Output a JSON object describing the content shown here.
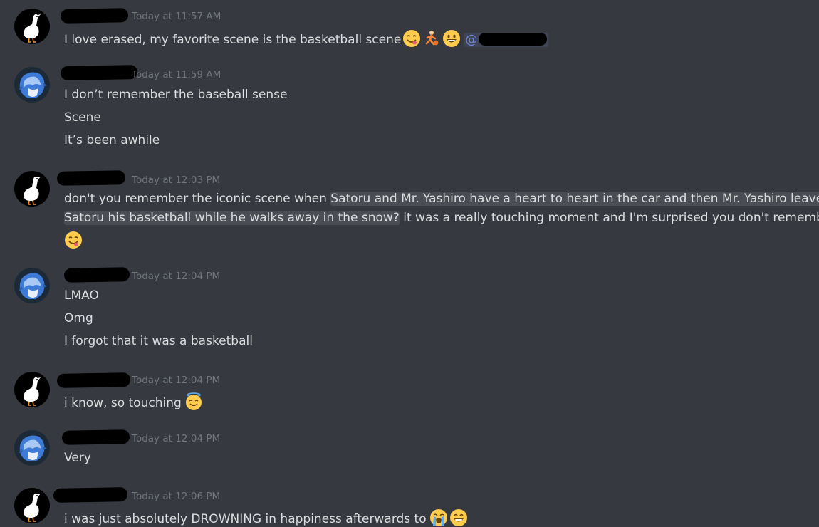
{
  "messages": [
    {
      "avatar": "goose-avatar",
      "time": "Today at 11:57 AM",
      "line1": "I love erased, my favorite scene is the basketball scene",
      "mention_prefix": "@"
    },
    {
      "avatar": "blue-hair-avatar",
      "time": "Today at 11:59 AM",
      "lines": [
        "I don’t remember the baseball sense",
        "Scene",
        "It’s been awhile"
      ]
    },
    {
      "avatar": "goose-avatar",
      "time": "Today at 12:03 PM",
      "part_a": "don't you remember the iconic scene when ",
      "highlight_1": "Satoru and Mr. Yashiro have a heart to heart in the car and then Mr. Yashiro leaves",
      "highlight_2": "Satoru his basketball while he walks away in the snow?",
      "part_b": " it was a really touching moment and I'm surprised you don't remember"
    },
    {
      "avatar": "blue-hair-avatar",
      "time": "Today at 12:04 PM",
      "lines": [
        "LMAO",
        "Omg",
        "I forgot that it was a basketball"
      ]
    },
    {
      "avatar": "goose-avatar",
      "time": "Today at 12:04 PM",
      "line1": "i know, so touching"
    },
    {
      "avatar": "blue-hair-avatar",
      "time": "Today at 12:04 PM",
      "line1": "Very"
    },
    {
      "avatar": "goose-avatar",
      "time": "Today at 12:06 PM",
      "line1": "i was just absolutely DROWNING in happiness afterwards to"
    }
  ],
  "emoji": {
    "yum": "face-savoring-food-emoji",
    "basketball_player": "person-bouncing-ball-emoji",
    "grin": "grinning-face-emoji",
    "innocent": "smiling-face-with-halo-emoji",
    "sob": "loudly-crying-face-emoji",
    "smile": "grinning-face-with-smiling-eyes-emoji"
  },
  "colors": {
    "background": "#36393f",
    "text": "#dcddde",
    "timestamp": "#72767d",
    "highlight": "#4a4d53",
    "mention": "#7289da"
  }
}
